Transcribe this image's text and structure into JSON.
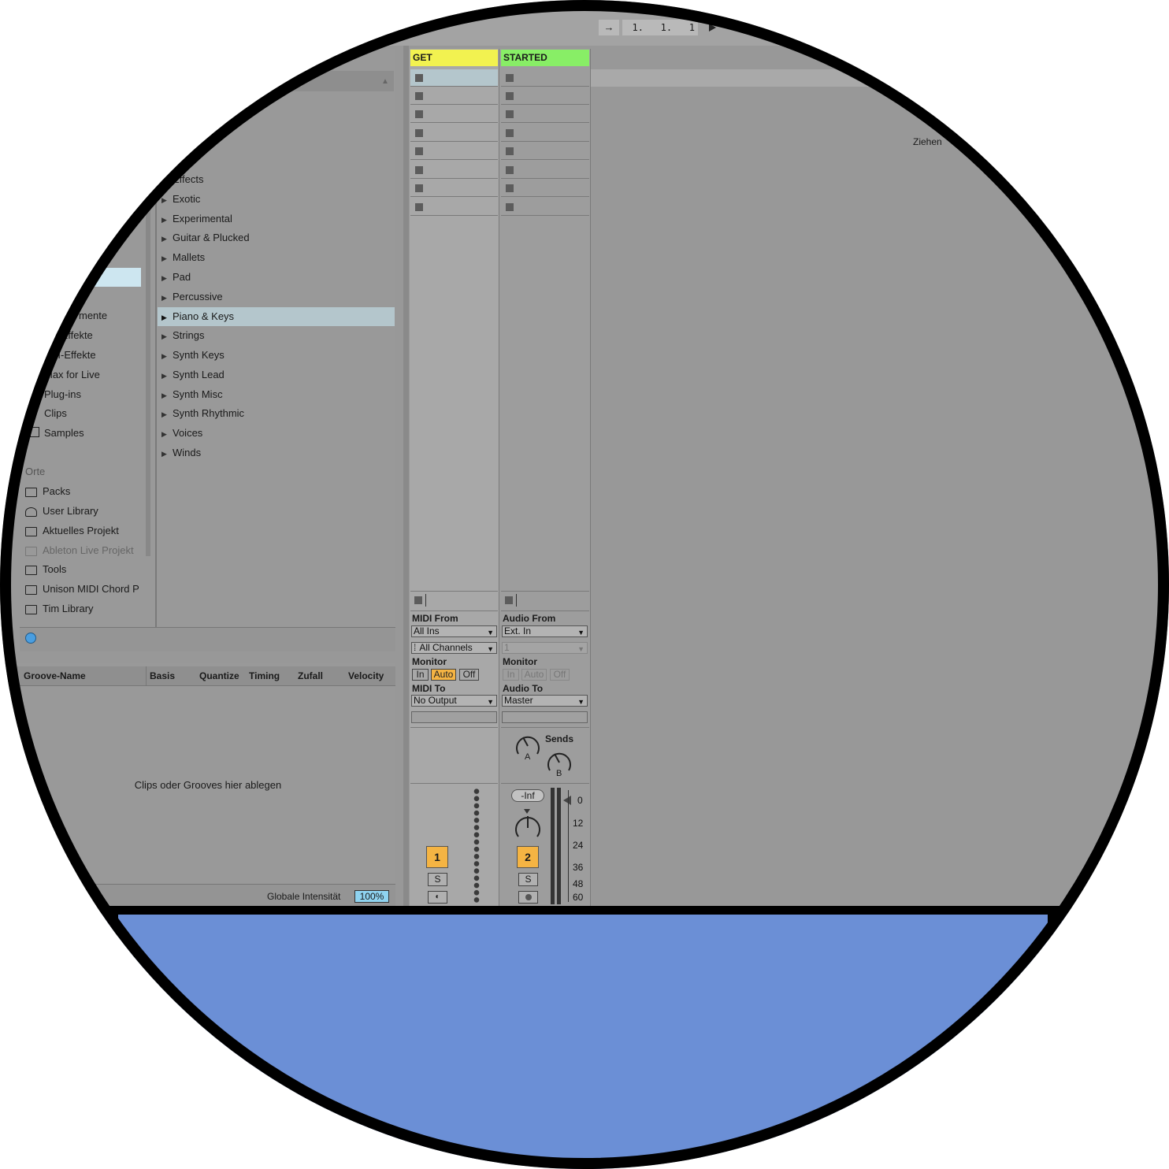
{
  "transport": {
    "loop_icon": "arrow-in-icon",
    "position": "1.   1.   1"
  },
  "browser": {
    "categories": [
      "Effects",
      "Exotic",
      "Experimental",
      "Guitar & Plucked",
      "Mallets",
      "Pad",
      "Percussive",
      "Piano & Keys",
      "Strings",
      "Synth Keys",
      "Synth Lead",
      "Synth Misc",
      "Synth Rhythmic",
      "Voices",
      "Winds"
    ],
    "selected_category": "Piano & Keys",
    "sidebar_partial": [
      "mente",
      "o-Effekte",
      "DI-Effekte",
      "Max for Live",
      "Plug-ins",
      "Clips",
      "Samples"
    ],
    "places_header": "Orte",
    "places": [
      "Packs",
      "User Library",
      "Aktuelles Projekt",
      "Ableton Live Projekt",
      "Tools",
      "Unison MIDI Chord P",
      "Tim Library"
    ]
  },
  "groove": {
    "columns": [
      "Groove-Name",
      "Basis",
      "Quantize",
      "Timing",
      "Zufall",
      "Velocity"
    ],
    "drop_hint": "Clips oder Grooves hier ablegen",
    "global_label": "Globale Intensität",
    "global_value": "100%"
  },
  "session_hint": "Ziehen",
  "tracks": [
    {
      "name": "GET",
      "color": "#f2f250",
      "input_label": "MIDI From",
      "input_value": "All Ins",
      "channel": "All Channels",
      "monitor_label": "Monitor",
      "monitor": [
        "In",
        "Auto",
        "Off"
      ],
      "output_label": "MIDI To",
      "output_value": "No Output",
      "number": "1",
      "solo": "S"
    },
    {
      "name": "STARTED",
      "color": "#88ee66",
      "input_label": "Audio From",
      "input_value": "Ext. In",
      "channel": "1",
      "monitor_label": "Monitor",
      "monitor": [
        "In",
        "Auto",
        "Off"
      ],
      "output_label": "Audio To",
      "output_value": "Master",
      "number": "2",
      "solo": "S",
      "sends_label": "Sends",
      "send_a": "A",
      "send_b": "B",
      "volume": "-Inf"
    }
  ],
  "meter_scale": [
    "0",
    "12",
    "24",
    "36",
    "48",
    "60"
  ],
  "colors": {
    "accent": "#f5b443",
    "bottom_panel": "#6b8fd6",
    "selection": "#b4c6cc"
  }
}
